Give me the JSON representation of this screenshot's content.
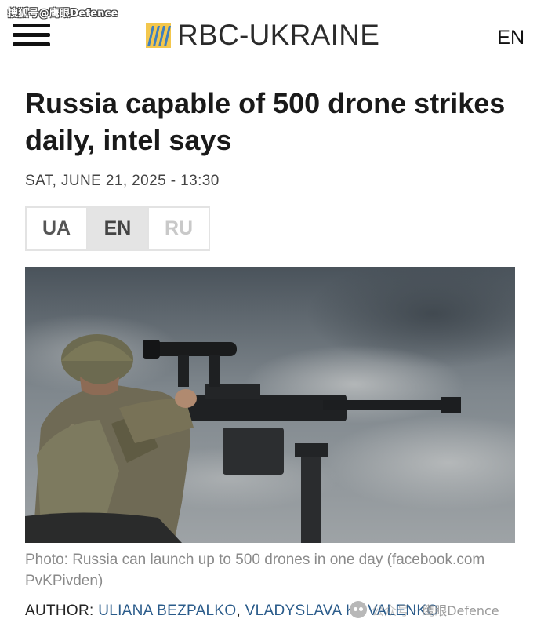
{
  "watermark_top": "搜狐号@鹰眼Defence",
  "header": {
    "logo_text": "RBC-UKRAINE",
    "language": "EN"
  },
  "article": {
    "title": "Russia capable of 500 drone strikes daily, intel says",
    "dateline": "SAT, JUNE 21, 2025 - 13:30",
    "language_options": [
      "UA",
      "EN",
      "RU"
    ],
    "active_language": "EN",
    "photo_caption": "Photo: Russia can launch up to 500 drones in one day (facebook.com PvKPivden)",
    "author_label": "AUTHOR:",
    "authors": [
      "ULIANA BEZPALKO",
      "VLADYSLAVA KOVALENKO"
    ],
    "author_separator": ","
  },
  "watermark_bottom": {
    "prefix": "公众号 ·",
    "text": "鹰眼Defence"
  },
  "colors": {
    "logo_blue": "#3f7fbf",
    "logo_gold": "#d9a53a",
    "author_link": "#2a5b8a",
    "active_lang_bg": "#e4e4e4"
  }
}
